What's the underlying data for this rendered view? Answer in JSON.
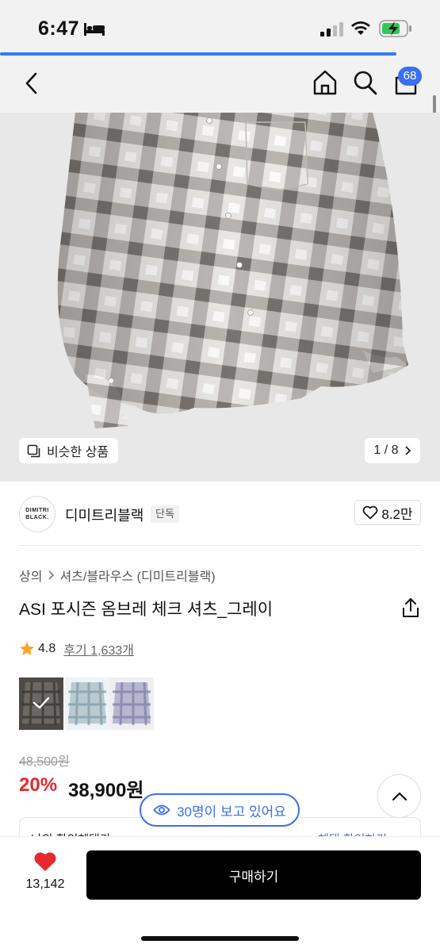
{
  "status_bar": {
    "time": "6:47",
    "icons": [
      "bed-icon",
      "signal-icon",
      "wifi-icon",
      "battery-charging-icon"
    ]
  },
  "loading": {
    "progress": 0.9,
    "color": "#3478f6"
  },
  "header": {
    "cart_badge": "68",
    "icons": [
      "back-chevron-icon",
      "home-icon",
      "search-icon",
      "cart-icon"
    ]
  },
  "gallery": {
    "similar_label": "비슷한 상품",
    "counter": "1 / 8"
  },
  "brand": {
    "logo_text": "DIMITRI BLACK.",
    "name": "디미트리블랙",
    "tag": "단독",
    "likes": "8.2만"
  },
  "breadcrumb": {
    "category": "상의",
    "subcategory": "셔츠/블라우스 (디미트리블랙)"
  },
  "product": {
    "title": "ASI 포시즌 옴브레 체크 셔츠_그레이",
    "rating": "4.8",
    "reviews": "후기 1,633개",
    "swatches": [
      "gray",
      "blue",
      "purple"
    ],
    "selected_swatch": "gray"
  },
  "price": {
    "original": "48,500원",
    "discount": "20%",
    "final": "38,900원"
  },
  "coupon": {
    "text": "나의 할인혜택가",
    "link": "혜택 확인하기"
  },
  "viewers": {
    "text": "30명이 보고 있어요"
  },
  "bottom": {
    "wish_count": "13,142",
    "buy_label": "구매하기"
  },
  "colors": {
    "accent": "#3b6ff0",
    "discount_red": "#e6282f",
    "heart_red": "#e6282f",
    "buy_button": "#000000"
  }
}
